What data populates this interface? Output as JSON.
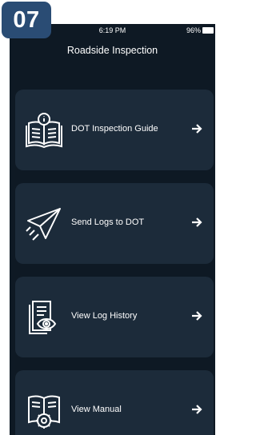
{
  "badge": {
    "number": "07"
  },
  "status_bar": {
    "time": "6:19 PM",
    "battery": "96%"
  },
  "header": {
    "title": "Roadside Inspection"
  },
  "menu": {
    "items": [
      {
        "label": "DOT Inspection Guide",
        "icon": "inspection-guide-book-icon"
      },
      {
        "label": "Send Logs to DOT",
        "icon": "paper-plane-icon"
      },
      {
        "label": "View Log History",
        "icon": "log-history-eye-icon"
      },
      {
        "label": "View Manual",
        "icon": "manual-gear-icon"
      }
    ]
  },
  "colors": {
    "background": "#0e1924",
    "card": "#1c2b3a",
    "badge": "#2a4c74",
    "text": "#ffffff"
  }
}
